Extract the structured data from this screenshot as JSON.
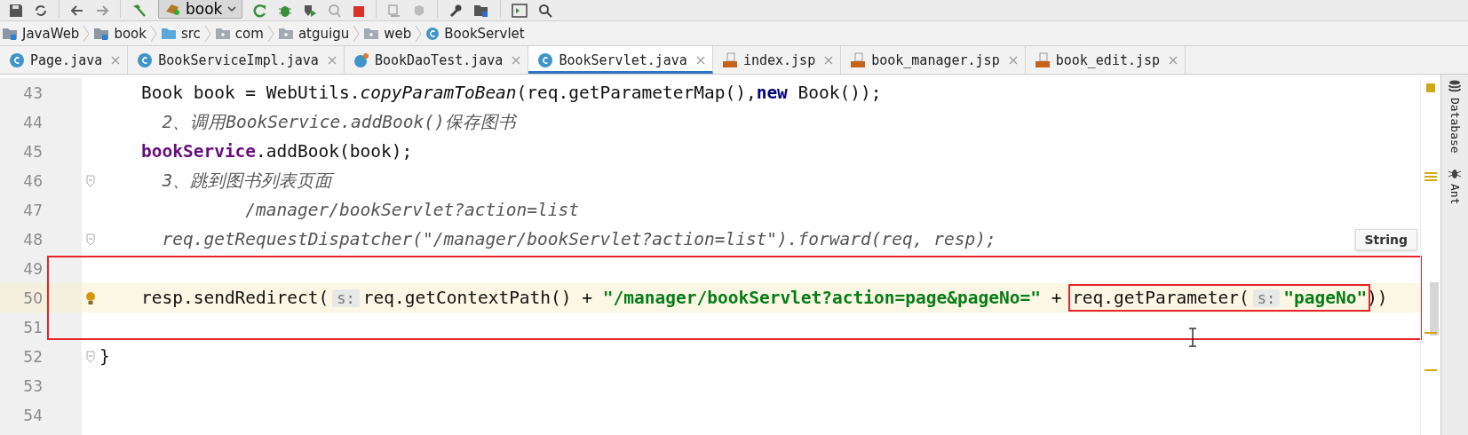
{
  "toolbar": {
    "run_config": "book"
  },
  "breadcrumb": [
    {
      "label": "JavaWeb",
      "kind": "module"
    },
    {
      "label": "book",
      "kind": "module"
    },
    {
      "label": "src",
      "kind": "source"
    },
    {
      "label": "com",
      "kind": "package"
    },
    {
      "label": "atguigu",
      "kind": "package"
    },
    {
      "label": "web",
      "kind": "package"
    },
    {
      "label": "BookServlet",
      "kind": "class"
    }
  ],
  "tabs": [
    {
      "label": "Page.java",
      "kind": "class",
      "selected": false
    },
    {
      "label": "BookServiceImpl.java",
      "kind": "class",
      "selected": false
    },
    {
      "label": "BookDaoTest.java",
      "kind": "test",
      "selected": false
    },
    {
      "label": "BookServlet.java",
      "kind": "class",
      "selected": true
    },
    {
      "label": "index.jsp",
      "kind": "jsp",
      "selected": false
    },
    {
      "label": "book_manager.jsp",
      "kind": "jsp",
      "selected": false
    },
    {
      "label": "book_edit.jsp",
      "kind": "jsp",
      "selected": false
    }
  ],
  "editor": {
    "lines": [
      {
        "number": "43",
        "tokens": [
          {
            "kind": "plain",
            "text": "    Book book = WebUtils."
          },
          {
            "kind": "static",
            "text": "copyParamToBean"
          },
          {
            "kind": "plain",
            "text": "(req.getParameterMap(),"
          },
          {
            "kind": "keyword",
            "text": "new"
          },
          {
            "kind": "plain",
            "text": " Book());"
          }
        ]
      },
      {
        "number": "44",
        "tokens": [
          {
            "kind": "comment",
            "text": "      2、调用BookService.addBook()保存图书"
          }
        ]
      },
      {
        "number": "45",
        "tokens": [
          {
            "kind": "field",
            "text": "    bookService"
          },
          {
            "kind": "plain",
            "text": ".addBook(book);"
          }
        ]
      },
      {
        "number": "46",
        "fold": true,
        "tokens": [
          {
            "kind": "comment",
            "text": "      3、跳到图书列表页面"
          }
        ]
      },
      {
        "number": "47",
        "tokens": [
          {
            "kind": "comment",
            "text": "              /manager/bookServlet?action=list"
          }
        ]
      },
      {
        "number": "48",
        "fold": true,
        "tokens": [
          {
            "kind": "comment",
            "text": "      req.getRequestDispatcher(\"/manager/bookServlet?action=list\").forward(req, resp);"
          }
        ]
      },
      {
        "number": "49",
        "outlined": true
      },
      {
        "number": "50",
        "outlined": true,
        "current": true,
        "bulb": true,
        "tokens": [
          {
            "kind": "plain",
            "text": "    resp.sendRedirect("
          },
          {
            "kind": "hint",
            "text": "s:"
          },
          {
            "kind": "plain",
            "text": "req.getContextPath() + "
          },
          {
            "kind": "string",
            "text": "\"/manager/bookServlet?action=page&pageNo=\""
          },
          {
            "kind": "plain",
            "text": " + "
          },
          {
            "kind": "group",
            "boxed": true,
            "tokens": [
              {
                "kind": "plain",
                "text": "req.getParameter("
              },
              {
                "kind": "hint",
                "text": "s:"
              },
              {
                "kind": "string",
                "text": "\"pageNo\""
              }
            ]
          },
          {
            "kind": "plain",
            "text": "))"
          }
        ]
      },
      {
        "number": "51",
        "outlined": true
      },
      {
        "number": "52",
        "fold": true,
        "tokens": [
          {
            "kind": "plain",
            "text": "}"
          }
        ]
      },
      {
        "number": "53"
      },
      {
        "number": "54"
      }
    ]
  },
  "tooltip": "String",
  "tool_windows": [
    {
      "label": "Database",
      "kind": "database"
    },
    {
      "label": "Ant",
      "kind": "ant"
    }
  ]
}
